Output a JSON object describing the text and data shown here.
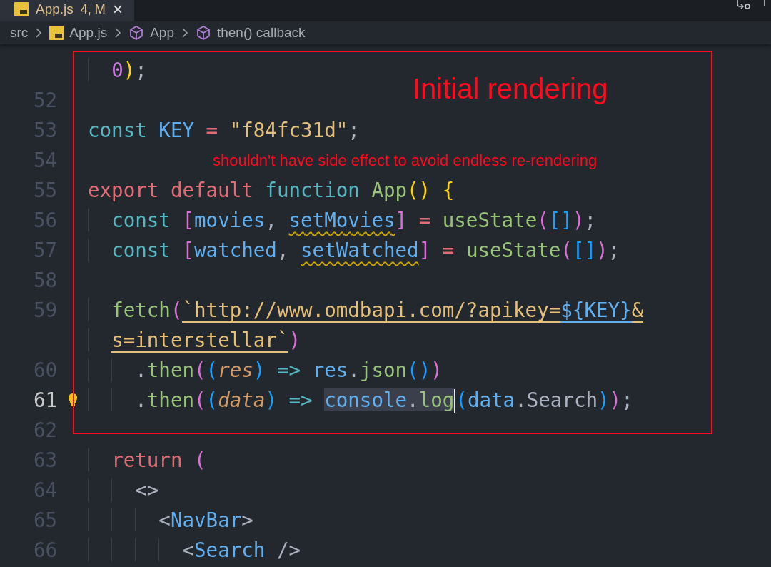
{
  "tab": {
    "title": "App.js",
    "badge": "4, M",
    "close": "×"
  },
  "breadcrumb": [
    {
      "label": "src",
      "kind": "folder"
    },
    {
      "label": "App.js",
      "kind": "file"
    },
    {
      "label": "App",
      "kind": "symbol"
    },
    {
      "label": "then() callback",
      "kind": "symbol"
    }
  ],
  "editor": {
    "lines": [
      {
        "tokens": [
          {
            "text": "  0",
            "kind": "number"
          },
          {
            "text": ")",
            "kind": "bracket"
          },
          {
            "text": ";",
            "kind": "plain"
          }
        ]
      },
      {
        "number": "52"
      },
      {
        "number": "53",
        "tokens": [
          {
            "text": "const ",
            "kind": "keyword"
          },
          {
            "text": "KEY",
            "kind": "variable"
          },
          {
            "text": " = ",
            "kind": "operator"
          },
          {
            "text": "\"f84fc31d\"",
            "kind": "string"
          },
          {
            "text": ";",
            "kind": "plain"
          }
        ]
      },
      {
        "number": "54"
      },
      {
        "number": "55",
        "tokens": [
          {
            "text": "export default ",
            "kind": "control"
          },
          {
            "text": "function ",
            "kind": "keyword"
          },
          {
            "text": "App",
            "kind": "function"
          },
          {
            "text": "() {",
            "kind": "bracket"
          }
        ]
      },
      {
        "number": "56",
        "tokens": [
          {
            "text": "  const ",
            "kind": "keyword"
          },
          {
            "text": "[",
            "kind": "bracket2"
          },
          {
            "text": "movies",
            "kind": "variable"
          },
          {
            "text": ", ",
            "kind": "plain"
          },
          {
            "text": "setMovies",
            "kind": "variable",
            "warning": true
          },
          {
            "text": "]",
            "kind": "bracket2"
          },
          {
            "text": " = ",
            "kind": "operator"
          },
          {
            "text": "useState",
            "kind": "function"
          },
          {
            "text": "(",
            "kind": "bracket2"
          },
          {
            "text": "[]",
            "kind": "bracket3"
          },
          {
            "text": ")",
            "kind": "bracket2"
          },
          {
            "text": ";",
            "kind": "plain"
          }
        ]
      },
      {
        "number": "57",
        "tokens": [
          {
            "text": "  const ",
            "kind": "keyword"
          },
          {
            "text": "[",
            "kind": "bracket2"
          },
          {
            "text": "watched",
            "kind": "variable"
          },
          {
            "text": ", ",
            "kind": "plain"
          },
          {
            "text": "setWatched",
            "kind": "variable",
            "warning": true
          },
          {
            "text": "]",
            "kind": "bracket2"
          },
          {
            "text": " = ",
            "kind": "operator"
          },
          {
            "text": "useState",
            "kind": "function"
          },
          {
            "text": "(",
            "kind": "bracket2"
          },
          {
            "text": "[]",
            "kind": "bracket3"
          },
          {
            "text": ")",
            "kind": "bracket2"
          },
          {
            "text": ";",
            "kind": "plain"
          }
        ]
      },
      {
        "number": "58"
      },
      {
        "number": "59",
        "tokens": [
          {
            "text": "  fetch",
            "kind": "function"
          },
          {
            "text": "(",
            "kind": "bracket2"
          },
          {
            "text": "`http://www.omdbapi.com/?apikey=",
            "kind": "string",
            "link": true
          },
          {
            "text": "${KEY}",
            "kind": "variable",
            "link": true
          },
          {
            "text": "&",
            "kind": "string",
            "link": true
          }
        ]
      },
      {
        "tokens": [
          {
            "text": "  s=interstellar`",
            "kind": "string",
            "link": true
          },
          {
            "text": ")",
            "kind": "bracket2"
          }
        ]
      },
      {
        "number": "60",
        "tokens": [
          {
            "text": "    .",
            "kind": "plain"
          },
          {
            "text": "then",
            "kind": "function"
          },
          {
            "text": "(",
            "kind": "bracket2"
          },
          {
            "text": "(",
            "kind": "bracket3"
          },
          {
            "text": "res",
            "kind": "parameter"
          },
          {
            "text": ")",
            "kind": "bracket3"
          },
          {
            "text": " => ",
            "kind": "keyword"
          },
          {
            "text": "res",
            "kind": "variable"
          },
          {
            "text": ".",
            "kind": "plain"
          },
          {
            "text": "json",
            "kind": "function"
          },
          {
            "text": "()",
            "kind": "bracket3"
          },
          {
            "text": ")",
            "kind": "bracket2"
          }
        ]
      },
      {
        "number": "61",
        "current": true,
        "lightbulb": true,
        "tokens": [
          {
            "text": "    .",
            "kind": "plain"
          },
          {
            "text": "then",
            "kind": "function"
          },
          {
            "text": "(",
            "kind": "bracket2"
          },
          {
            "text": "(",
            "kind": "bracket3"
          },
          {
            "text": "data",
            "kind": "parameter"
          },
          {
            "text": ")",
            "kind": "bracket3"
          },
          {
            "text": " => ",
            "kind": "keyword"
          },
          {
            "text": "console",
            "kind": "variable",
            "selected": true
          },
          {
            "text": ".",
            "kind": "plain",
            "selected": true
          },
          {
            "text": "log",
            "kind": "function",
            "selected": true,
            "caret": true
          },
          {
            "text": "(",
            "kind": "bracket3"
          },
          {
            "text": "data",
            "kind": "variable"
          },
          {
            "text": ".",
            "kind": "plain"
          },
          {
            "text": "Search",
            "kind": "property"
          },
          {
            "text": ")",
            "kind": "bracket3"
          },
          {
            "text": ")",
            "kind": "bracket2"
          },
          {
            "text": ";",
            "kind": "plain"
          }
        ]
      },
      {
        "number": "62"
      },
      {
        "number": "63",
        "tokens": [
          {
            "text": "  return ",
            "kind": "control"
          },
          {
            "text": "(",
            "kind": "bracket2"
          }
        ]
      },
      {
        "number": "64",
        "tokens": [
          {
            "text": "    <>",
            "kind": "plain"
          }
        ]
      },
      {
        "number": "65",
        "tokens": [
          {
            "text": "      <",
            "kind": "plain"
          },
          {
            "text": "NavBar",
            "kind": "variable"
          },
          {
            "text": ">",
            "kind": "plain"
          }
        ]
      },
      {
        "number": "66",
        "tokens": [
          {
            "text": "        <",
            "kind": "plain"
          },
          {
            "text": "Search",
            "kind": "variable"
          },
          {
            "text": " />",
            "kind": "plain"
          }
        ]
      }
    ]
  },
  "annotation": {
    "title": "Initial rendering",
    "note": "shouldn't have side effect to avoid endless re-rendering"
  }
}
